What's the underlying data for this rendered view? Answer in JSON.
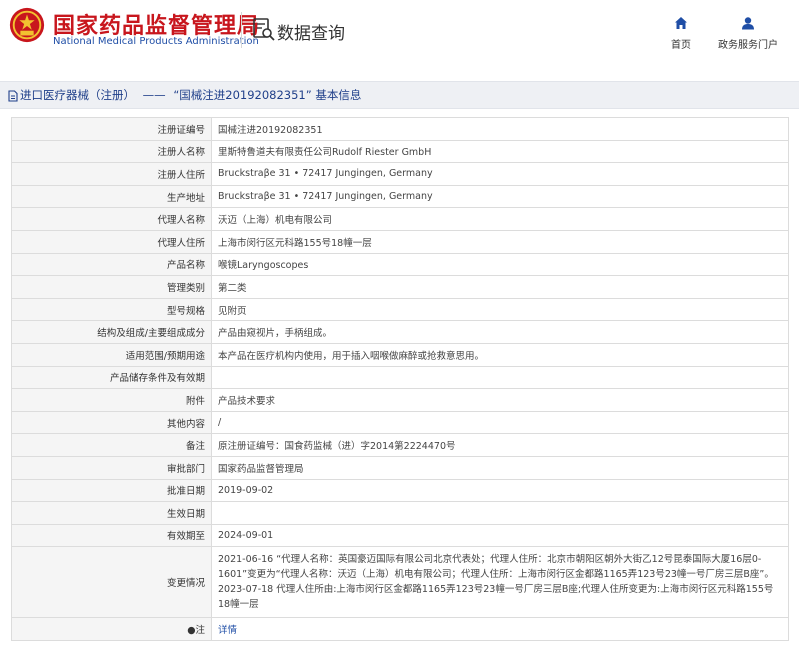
{
  "header": {
    "site_name_cn": "国家药品监督管理局",
    "site_name_en": "National Medical Products Administration",
    "section_title": "数据查询",
    "nav": {
      "home": "首页",
      "portal": "政务服务门户"
    }
  },
  "breadcrumb": {
    "category": "进口医疗器械（注册）",
    "separator": "——",
    "record": "“国械注进20192082351”",
    "suffix": "基本信息"
  },
  "record": {
    "rows": [
      {
        "label": "注册证编号",
        "value": "国械注进20192082351"
      },
      {
        "label": "注册人名称",
        "value": "里斯特鲁道夫有限责任公司Rudolf Riester GmbH"
      },
      {
        "label": "注册人住所",
        "value": "Bruckstraβe 31 • 72417 Jungingen, Germany"
      },
      {
        "label": "生产地址",
        "value": "Bruckstraβe 31 • 72417 Jungingen, Germany"
      },
      {
        "label": "代理人名称",
        "value": "沃迈（上海）机电有限公司"
      },
      {
        "label": "代理人住所",
        "value": "上海市闵行区元科路155号18幢一层"
      },
      {
        "label": "产品名称",
        "value": "喉镜Laryngoscopes"
      },
      {
        "label": "管理类别",
        "value": "第二类"
      },
      {
        "label": "型号规格",
        "value": "见附页"
      },
      {
        "label": "结构及组成/主要组成成分",
        "value": "产品由窥视片，手柄组成。"
      },
      {
        "label": "适用范围/预期用途",
        "value": "本产品在医疗机构内使用，用于插入咽喉做麻醉或抢救意思用。"
      },
      {
        "label": "产品储存条件及有效期",
        "value": ""
      },
      {
        "label": "附件",
        "value": "产品技术要求"
      },
      {
        "label": "其他内容",
        "value": "/"
      },
      {
        "label": "备注",
        "value": "原注册证编号：国食药监械（进）字2014第2224470号"
      },
      {
        "label": "审批部门",
        "value": "国家药品监督管理局"
      },
      {
        "label": "批准日期",
        "value": "2019-09-02"
      },
      {
        "label": "生效日期",
        "value": ""
      },
      {
        "label": "有效期至",
        "value": "2024-09-01"
      }
    ],
    "change_label": "变更情况",
    "change_text": "2021-06-16 “代理人名称：英国豪迈国际有限公司北京代表处；代理人住所：北京市朝阳区朝外大街乙12号昆泰国际大厦16层0-1601”变更为“代理人名称：沃迈（上海）机电有限公司；代理人住所：上海市闵行区金都路1165弄123号23幢一号厂房三层B座”。2023-07-18 代理人住所由:上海市闵行区金都路1165弄123号23幢一号厂房三层B座;代理人住所变更为:上海市闵行区元科路155号18幢一层",
    "note_label": "●注",
    "note_value": "详情"
  },
  "colors": {
    "brand_red": "#c8161d",
    "brand_blue": "#1f4ea6",
    "label_bg": "#f5f5f5"
  }
}
